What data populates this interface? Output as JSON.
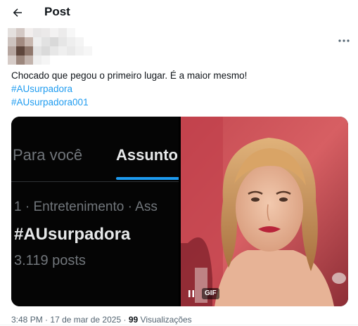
{
  "header": {
    "title": "Post",
    "back_icon": "arrow-left-icon"
  },
  "author": {
    "avatar": "pixelated-avatar"
  },
  "more_icon": "more-horizontal-icon",
  "tweet": {
    "text": "Chocado que pegou o primeiro lugar. É a maior mesmo!",
    "hashtags": [
      "#AUsurpadora",
      "#AUsurpadora001"
    ]
  },
  "media": {
    "screenshot": {
      "tab_for_you": "Para você",
      "tab_trending": "Assunto",
      "trend_meta": "1 · Entretenimento · Ass",
      "trend_name": "#AUsurpadora",
      "trend_count": "3.119 posts"
    },
    "gif": {
      "badge": "GIF",
      "pause_icon": "pause-icon"
    }
  },
  "footer": {
    "time": "3:48 PM",
    "date": "17 de mar de 2025",
    "views_count": "99",
    "views_label": "Visualizações"
  },
  "colors": {
    "link": "#1d9bf0",
    "text": "#0f1419",
    "muted": "#536471"
  }
}
